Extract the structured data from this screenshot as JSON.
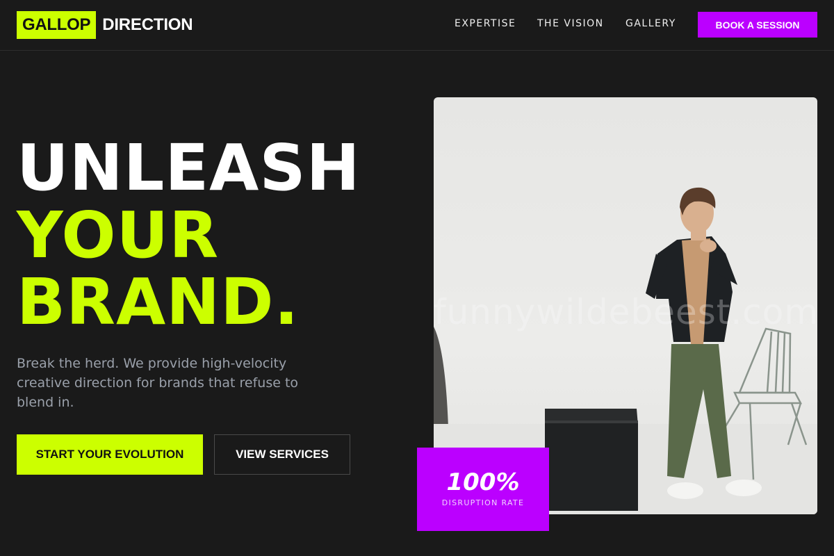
{
  "brand": {
    "badge": "GALLOP",
    "name": "DIRECTION"
  },
  "nav": {
    "items": [
      "EXPERTISE",
      "THE VISION",
      "GALLERY"
    ],
    "cta": "BOOK A SESSION"
  },
  "hero": {
    "line1": "UNLEASH",
    "line2": "YOUR",
    "line3": "BRAND.",
    "subtitle": "Break the herd. We provide high-velocity creative direction for brands that refuse to blend in.",
    "primary_cta": "START YOUR EVOLUTION",
    "secondary_cta": "VIEW SERVICES"
  },
  "photo": {
    "watermark": "funnywildebeest.com"
  },
  "stat": {
    "value": "100%",
    "label": "DISRUPTION RATE"
  },
  "colors": {
    "accent": "#ccff00",
    "brand_purple": "#bb00ff",
    "background": "#1a1a1a",
    "subtitle": "#9aa0aa"
  }
}
